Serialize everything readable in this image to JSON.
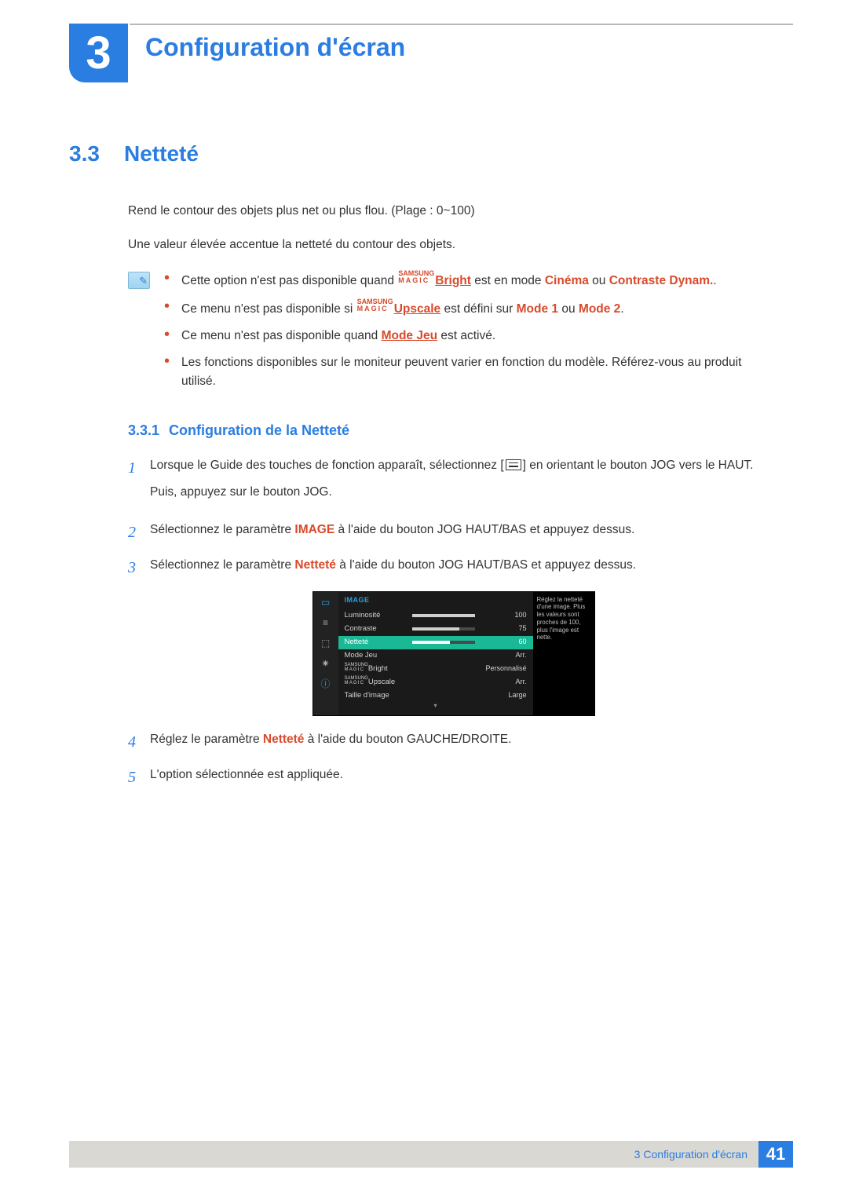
{
  "chapter": {
    "number": "3",
    "title": "Configuration d'écran"
  },
  "section": {
    "number": "3.3",
    "title": "Netteté"
  },
  "intro": {
    "p1": "Rend le contour des objets plus net ou plus flou. (Plage : 0~100)",
    "p2": "Une valeur élevée accentue la netteté du contour des objets."
  },
  "magic": {
    "top": "SAMSUNG",
    "bottom": "MAGIC"
  },
  "notes": {
    "n1_a": "Cette option n'est pas disponible quand ",
    "n1_b": "Bright",
    "n1_c": " est en mode ",
    "n1_d": "Cinéma",
    "n1_e": " ou ",
    "n1_f": "Contraste Dynam.",
    "n1_g": ".",
    "n2_a": "Ce menu n'est pas disponible si ",
    "n2_b": "Upscale",
    "n2_c": " est défini sur ",
    "n2_d": "Mode 1",
    "n2_e": " ou ",
    "n2_f": "Mode 2",
    "n2_g": ".",
    "n3_a": "Ce menu n'est pas disponible quand ",
    "n3_b": "Mode Jeu",
    "n3_c": " est activé.",
    "n4": "Les fonctions disponibles sur le moniteur peuvent varier en fonction du modèle. Référez-vous au produit utilisé."
  },
  "subsection": {
    "number": "3.3.1",
    "title": "Configuration de la Netteté"
  },
  "steps": {
    "s1a": "Lorsque le Guide des touches de fonction apparaît, sélectionnez [",
    "s1b": "] en orientant le bouton JOG vers le HAUT.",
    "s1c": "Puis, appuyez sur le bouton JOG.",
    "s2a": "Sélectionnez le paramètre ",
    "s2b": "IMAGE",
    "s2c": " à l'aide du bouton JOG HAUT/BAS et appuyez dessus.",
    "s3a": "Sélectionnez le paramètre ",
    "s3b": "Netteté",
    "s3c": " à l'aide du bouton JOG HAUT/BAS et appuyez dessus.",
    "s4a": "Réglez le paramètre ",
    "s4b": "Netteté",
    "s4c": " à l'aide du bouton GAUCHE/DROITE.",
    "s5": "L'option sélectionnée est appliquée."
  },
  "osd": {
    "title": "IMAGE",
    "help": "Réglez la netteté d'une image. Plus les valeurs sont proches de 100, plus l'image est nette.",
    "rows": {
      "luminosite": {
        "label": "Luminosité",
        "value": "100",
        "fill": 100
      },
      "contraste": {
        "label": "Contraste",
        "value": "75",
        "fill": 75
      },
      "nettete": {
        "label": "Netteté",
        "value": "60",
        "fill": 60
      },
      "modejeu": {
        "label": "Mode Jeu",
        "value": "Arr."
      },
      "bright": {
        "label": "Bright",
        "value": "Personnalisé"
      },
      "upscale": {
        "label": "Upscale",
        "value": "Arr."
      },
      "taille": {
        "label": "Taille d'image",
        "value": "Large"
      }
    }
  },
  "footer": {
    "label": "3 Configuration d'écran",
    "page": "41"
  }
}
